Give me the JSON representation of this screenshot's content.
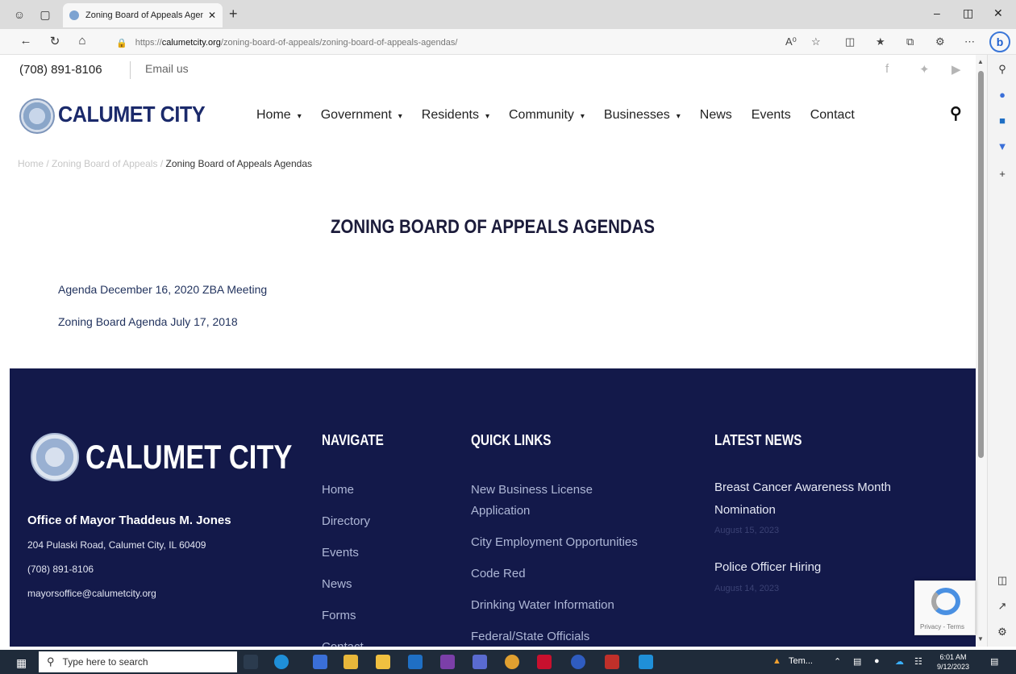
{
  "browser": {
    "tab_title": "Zoning Board of Appeals Agend",
    "url_prefix": "https://",
    "url_domain": "calumetcity.org",
    "url_path": "/zoning-board-of-appeals/zoning-board-of-appeals-agendas/"
  },
  "topbar": {
    "phone": "(708) 891-8106",
    "email_label": "Email us"
  },
  "header": {
    "logo_text": "CALUMET CITY",
    "menu": [
      {
        "label": "Home",
        "dropdown": true
      },
      {
        "label": "Government",
        "dropdown": true
      },
      {
        "label": "Residents",
        "dropdown": true
      },
      {
        "label": "Community",
        "dropdown": true
      },
      {
        "label": "Businesses",
        "dropdown": true
      },
      {
        "label": "News",
        "dropdown": false
      },
      {
        "label": "Events",
        "dropdown": false
      },
      {
        "label": "Contact",
        "dropdown": false
      }
    ]
  },
  "breadcrumb": {
    "home": "Home",
    "sep": "/",
    "parent": "Zoning Board of Appeals",
    "current": "Zoning Board of Appeals Agendas"
  },
  "main": {
    "title": "ZONING BOARD OF APPEALS AGENDAS",
    "links": [
      "Agenda December 16, 2020 ZBA Meeting",
      "Zoning Board Agenda July 17, 2018"
    ]
  },
  "footer": {
    "logo_text": "CALUMET CITY",
    "office": "Office of Mayor Thaddeus M. Jones",
    "address": "204 Pulaski Road, Calumet City, IL  60409",
    "phone": "(708) 891-8106",
    "email": "mayorsoffice@calumetcity.org",
    "navigate_heading": "NAVIGATE",
    "navigate": [
      "Home",
      "Directory",
      "Events",
      "News",
      "Forms",
      "Contact"
    ],
    "quick_heading": "QUICK LINKS",
    "quick": [
      "New Business License Application",
      "City Employment Opportunities",
      "Code Red",
      "Drinking Water Information",
      "Federal/State Officials"
    ],
    "news_heading": "LATEST NEWS",
    "news": [
      {
        "title": "Breast Cancer Awareness Month Nomination",
        "date": "August 15, 2023"
      },
      {
        "title": "Police Officer Hiring",
        "date": "August 14, 2023"
      }
    ]
  },
  "recaptcha": {
    "text": "Privacy - Terms"
  },
  "taskbar": {
    "search_placeholder": "Type here to search",
    "weather": "Tem...",
    "time": "6:01 AM",
    "date": "9/12/2023"
  },
  "colors": {
    "brand_navy": "#1b2a6b",
    "footer_bg": "#13194a"
  }
}
